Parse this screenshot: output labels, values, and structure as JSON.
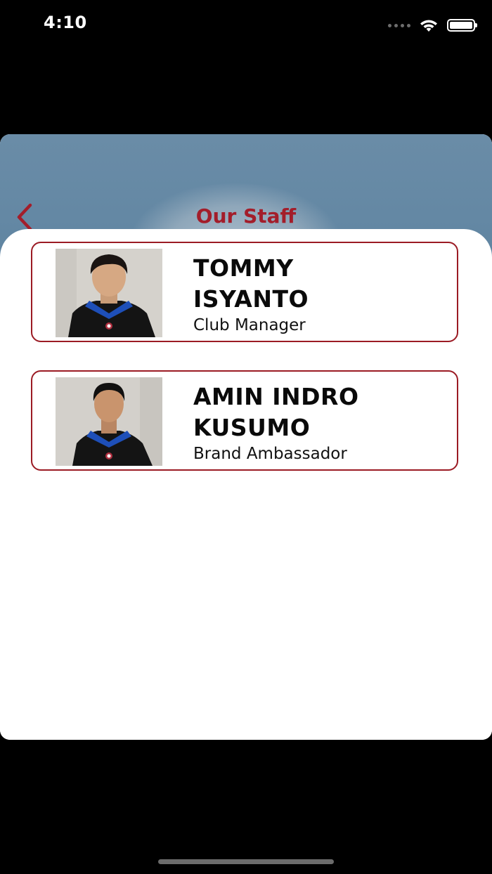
{
  "status_bar": {
    "time": "4:10",
    "icons": [
      "cellular-dots-icon",
      "wifi-icon",
      "battery-icon"
    ]
  },
  "header": {
    "title": "Our Staff",
    "back_icon": "chevron-left-icon"
  },
  "staff": [
    {
      "name_line1": "TOMMY",
      "name_line2": "ISYANTO",
      "role": "Club Manager"
    },
    {
      "name_line1": "AMIN INDRO",
      "name_line2": "KUSUMO",
      "role": "Brand Ambassador"
    }
  ],
  "colors": {
    "accent": "#a31d2a",
    "card_border": "#9b1b24",
    "hero_background": "#6488a4",
    "shirt_black": "#111111",
    "shirt_collar_blue": "#1e4fb8"
  }
}
